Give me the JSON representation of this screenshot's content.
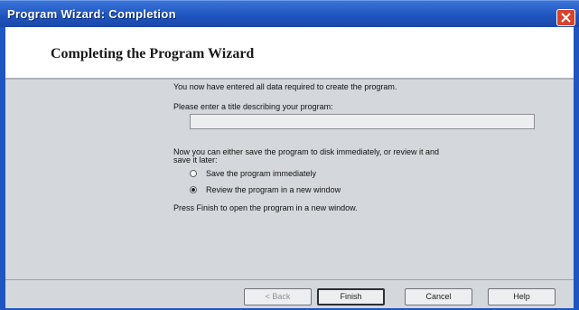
{
  "window": {
    "title": "Program Wizard: Completion"
  },
  "header": {
    "heading": "Completing the Program Wizard"
  },
  "body": {
    "intro": "You now have entered all data required to create the program.",
    "title_prompt": "Please enter a title describing your program:",
    "title_value": "",
    "save_prompt_line1": "Now you can either save the program to disk immediately, or review it and",
    "save_prompt_line2": "save it later:",
    "options": [
      {
        "label": "Save the program immediately",
        "checked": false
      },
      {
        "label": "Review the program in a new window",
        "checked": true
      }
    ],
    "finish_note": "Press Finish to open the program in a new window."
  },
  "footer": {
    "back": "< Back",
    "finish": "Finish",
    "cancel": "Cancel",
    "help": "Help"
  },
  "colors": {
    "titlebar": "#1f55c0",
    "close": "#d9432b",
    "panel": "#d4d7dc"
  }
}
